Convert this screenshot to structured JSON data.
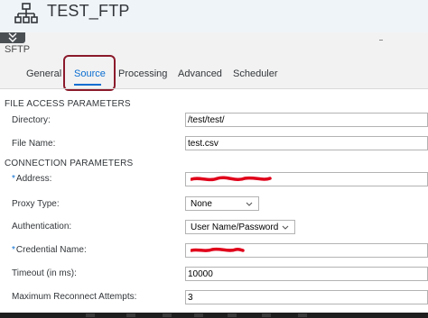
{
  "header": {
    "title": "TEST_FTP",
    "icon": "hierarchy-icon"
  },
  "adapter": {
    "name": "SFTP"
  },
  "tabs": [
    {
      "label": "General"
    },
    {
      "label": "Source"
    },
    {
      "label": "Processing"
    },
    {
      "label": "Advanced"
    },
    {
      "label": "Scheduler"
    }
  ],
  "active_tab": "Source",
  "sections": {
    "file_access": "FILE ACCESS PARAMETERS",
    "connection": "CONNECTION PARAMETERS"
  },
  "fields": {
    "directory": {
      "label": "Directory:",
      "value": "/test/test/"
    },
    "file_name": {
      "label": "File Name:",
      "value": "test.csv"
    },
    "address": {
      "required_mark": "*",
      "label": "Address:",
      "value": ""
    },
    "proxy_type": {
      "label": "Proxy Type:",
      "value": "None"
    },
    "authentication": {
      "label": "Authentication:",
      "value": "User Name/Password"
    },
    "credential_name": {
      "required_mark": "*",
      "label": "Credential Name:",
      "value": ""
    },
    "timeout": {
      "label": "Timeout (in ms):",
      "value": "10000"
    },
    "max_reconnect": {
      "label": "Maximum Reconnect Attempts:",
      "value": "3"
    }
  },
  "colors": {
    "accent": "#0a6ed1",
    "highlight_box": "#8b1a2b",
    "redaction": "#e0001a"
  }
}
